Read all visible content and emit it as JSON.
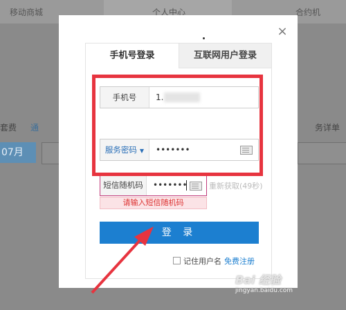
{
  "background": {
    "nav_left": "移动商城",
    "nav_center": "个人中心",
    "nav_right": "合约机",
    "left_text_a": "套费",
    "left_text_b": "通",
    "month": "07月",
    "right_text": "务详单"
  },
  "modal": {
    "close_symbol": "×",
    "tabs": [
      {
        "label": "手机号登录"
      },
      {
        "label": "互联网用户登录"
      }
    ],
    "phone": {
      "label": "手机号",
      "value": "1."
    },
    "password": {
      "label": "服务密码",
      "caret": "▼",
      "value": "•••••••"
    },
    "sms": {
      "label": "短信随机码",
      "value": "•••••••",
      "resend": "重新获取(49秒)",
      "error": "请输入短信随机码"
    },
    "login_label": "登 录",
    "remember_label": "记住用户名",
    "register_label": "免费注册"
  },
  "watermark": {
    "brand": "Bai 经验",
    "url": "jingyan.baidu.com"
  },
  "colors": {
    "highlight": "#e7343f",
    "primary": "#1c7fd0"
  }
}
